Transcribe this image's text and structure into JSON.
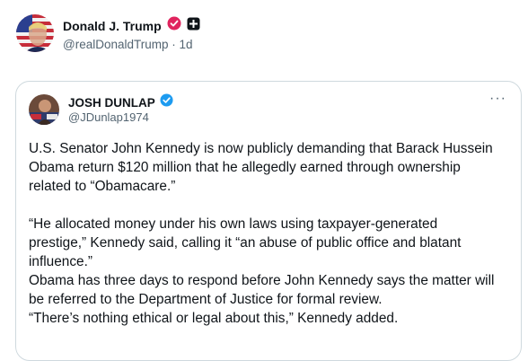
{
  "outer_post": {
    "display_name": "Donald J. Trump",
    "handle": "@realDonaldTrump",
    "separator": "·",
    "time": "1d",
    "verified_color": "#e0245e",
    "affiliation_badge_color": "#0f1419",
    "avatar_icon": "us-flag-portrait"
  },
  "quoted_post": {
    "display_name": "JOSH DUNLAP",
    "handle": "@JDunlap1974",
    "verified_color": "#1d9bf0",
    "more_label": "···",
    "avatar_icon": "person-portrait",
    "paragraphs": [
      "U.S. Senator John Kennedy is now publicly demanding that Barack Hussein Obama return $120 million that he allegedly earned through ownership related to “Obamacare.”",
      "",
      "“He allocated money under his own laws using taxpayer-generated prestige,” Kennedy said, calling it “an abuse of public office and blatant influence.”",
      "Obama has three days to respond before John Kennedy says the matter will be referred to the Department of Justice for formal review.",
      "“There’s nothing ethical or legal about this,” Kennedy added."
    ]
  }
}
